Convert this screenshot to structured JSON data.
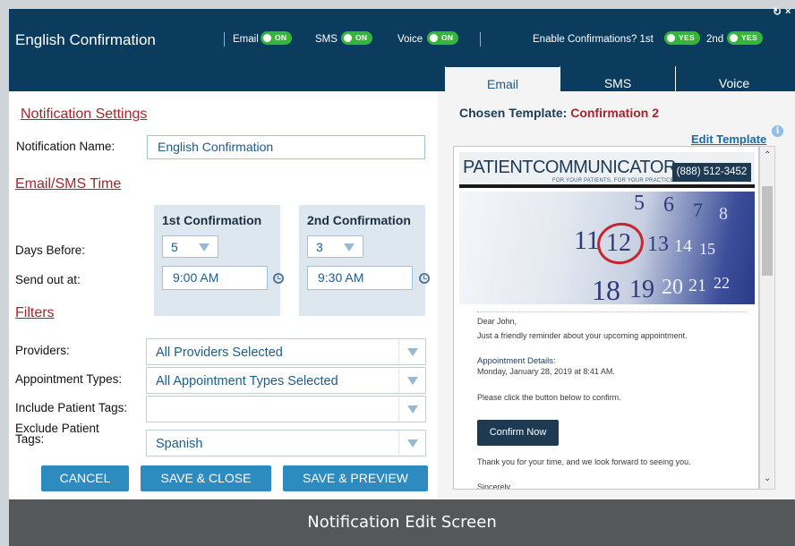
{
  "header": {
    "title": "English Confirmation",
    "channels": [
      {
        "label": "Email",
        "state": "ON"
      },
      {
        "label": "SMS",
        "state": "ON"
      },
      {
        "label": "Voice",
        "state": "ON"
      }
    ],
    "enable_label": "Enable Confirmations? 1st",
    "enable_first": "YES",
    "enable_second_label": "2nd",
    "enable_second": "YES",
    "refresh_icon": "↻",
    "close_icon": "×",
    "toggle_color": "#36b53a"
  },
  "tabs": [
    {
      "label": "Email",
      "active": true
    },
    {
      "label": "SMS",
      "active": false
    },
    {
      "label": "Voice",
      "active": false
    }
  ],
  "notification_settings": {
    "heading": "Notification Settings",
    "name_label": "Notification Name:",
    "name_value": "English Confirmation"
  },
  "time": {
    "heading": "Email/SMS Time",
    "first_header": "1st Confirmation",
    "second_header": "2nd Confirmation",
    "days_label": "Days Before:",
    "send_label": "Send out at:",
    "first_days": "5",
    "second_days": "3",
    "first_time": "9:00 AM",
    "second_time": "9:30 AM"
  },
  "filters": {
    "heading": "Filters",
    "providers_label": "Providers:",
    "providers_value": "All Providers Selected",
    "appt_label": "Appointment Types:",
    "appt_value": "All Appointment Types Selected",
    "include_label": "Include Patient Tags:",
    "include_value": "",
    "exclude_label_1": "Exclude Patient",
    "exclude_label_2": "Tags:",
    "exclude_value": "Spanish"
  },
  "buttons": {
    "cancel": "CANCEL",
    "save_close": "SAVE & CLOSE",
    "save_preview": "SAVE & PREVIEW"
  },
  "template": {
    "chosen_label": "Chosen Template:",
    "chosen_value": "Confirmation 2",
    "edit_link": "Edit Template",
    "info_icon": "i"
  },
  "email_preview": {
    "logo_text": "PATIENTCOMMUNICATOR",
    "logo_tagline": "FOR YOUR PATIENTS. FOR YOUR PRACTICE.",
    "phone": "(888) 512-3452",
    "greeting": "Dear John,",
    "intro": "Just a friendly reminder about your upcoming appointment.",
    "details_heading": "Appointment Details:",
    "details_value": "Monday, January 28, 2019 at 8:41 AM.",
    "instruction": "Please click the button below to confirm.",
    "confirm_button": "Confirm Now",
    "thanks": "Thank you for your time, and we look forward to seeing you.",
    "signoff": "Sincerely,",
    "calendar_numbers": [
      "5",
      "6",
      "7",
      "8",
      "11",
      "12",
      "13",
      "14",
      "15",
      "18",
      "19",
      "20",
      "21",
      "22"
    ]
  },
  "caption": "Notification Edit Screen"
}
